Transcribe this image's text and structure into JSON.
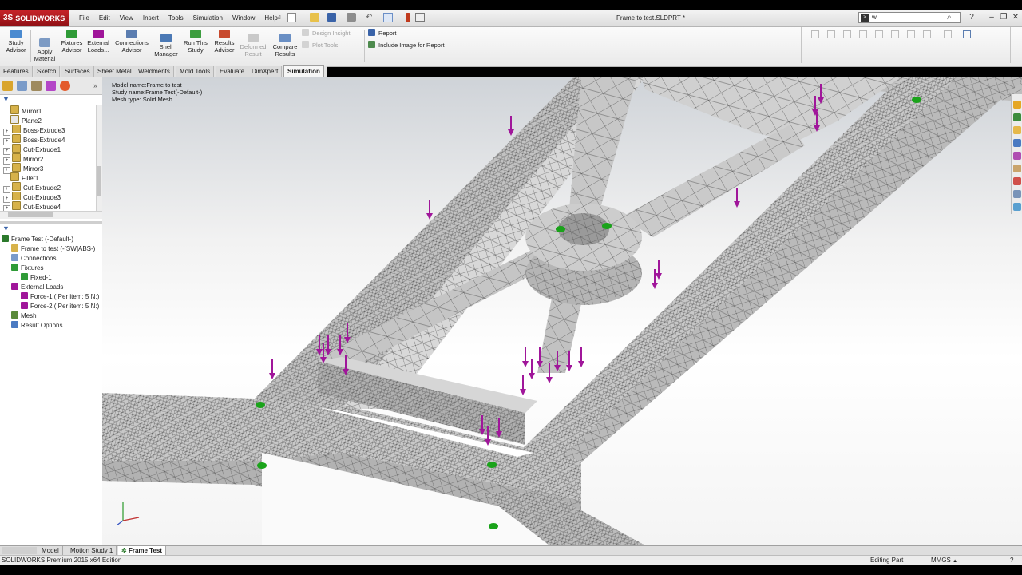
{
  "app": {
    "logo": "SOLIDWORKS",
    "logo_mark": "3S",
    "document_title": "Frame to test.SLDPRT *",
    "search_value": "w"
  },
  "menu": [
    "File",
    "Edit",
    "View",
    "Insert",
    "Tools",
    "Simulation",
    "Window",
    "Help"
  ],
  "command_manager": {
    "buttons": [
      {
        "label": "Study\nAdvisor",
        "icon": "study-advisor-icon"
      },
      {
        "label": "Apply\nMaterial",
        "icon": "apply-material-icon"
      },
      {
        "label": "Fixtures\nAdvisor",
        "icon": "fixtures-icon"
      },
      {
        "label": "External\nLoads...",
        "icon": "external-loads-icon"
      },
      {
        "label": "Connections\nAdvisor",
        "icon": "connections-icon"
      },
      {
        "label": "Shell\nManager",
        "icon": "shell-manager-icon"
      },
      {
        "label": "Run This\nStudy",
        "icon": "run-study-icon"
      },
      {
        "label": "Results\nAdvisor",
        "icon": "results-advisor-icon"
      },
      {
        "label": "Deformed\nResult",
        "icon": "deformed-result-icon",
        "disabled": true
      },
      {
        "label": "Compare\nResults",
        "icon": "compare-results-icon"
      }
    ],
    "design_insight": "Design Insight",
    "plot_tools": "Plot Tools",
    "report": "Report",
    "include_image": "Include Image for Report"
  },
  "tabs": [
    "Features",
    "Sketch",
    "Surfaces",
    "Sheet Metal",
    "Weldments",
    "Mold Tools",
    "Evaluate",
    "DimXpert",
    "Simulation"
  ],
  "active_tab": "Simulation",
  "feature_tree": [
    {
      "label": "Mirror1",
      "expand": false
    },
    {
      "label": "Plane2",
      "expand": false
    },
    {
      "label": "Boss-Extrude3",
      "expand": true
    },
    {
      "label": "Boss-Extrude4",
      "expand": true
    },
    {
      "label": "Cut-Extrude1",
      "expand": true
    },
    {
      "label": "Mirror2",
      "expand": true
    },
    {
      "label": "Mirror3",
      "expand": true
    },
    {
      "label": "Fillet1",
      "expand": false
    },
    {
      "label": "Cut-Extrude2",
      "expand": true
    },
    {
      "label": "Cut-Extrude3",
      "expand": true
    },
    {
      "label": "Cut-Extrude4",
      "expand": true
    }
  ],
  "study_tree": [
    {
      "label": "Frame Test (-Default-)",
      "level": 0
    },
    {
      "label": "Frame to test (-[SW]ABS-)",
      "level": 1
    },
    {
      "label": "Connections",
      "level": 1
    },
    {
      "label": "Fixtures",
      "level": 1
    },
    {
      "label": "Fixed-1",
      "level": 2
    },
    {
      "label": "External Loads",
      "level": 1
    },
    {
      "label": "Force-1 (:Per item: 5 N:)",
      "level": 2
    },
    {
      "label": "Force-2 (:Per item: 5 N:)",
      "level": 2
    },
    {
      "label": "Mesh",
      "level": 1
    },
    {
      "label": "Result Options",
      "level": 1
    }
  ],
  "viewport": {
    "model_name": "Model name:Frame to test",
    "study_name": "Study name:Frame Test(-Default-)",
    "mesh_type": "Mesh type: Solid Mesh"
  },
  "bottom_tabs": [
    "Model",
    "Motion Study 1",
    "Frame Test"
  ],
  "active_bottom_tab": "Frame Test",
  "status": {
    "edition": "SOLIDWORKS Premium 2015 x64 Edition",
    "mode": "Editing Part",
    "units": "MMGS"
  },
  "colors": {
    "load_arrow": "#a0169a",
    "fixture": "#1aa31a",
    "mesh_face": "#c9c9c9",
    "mesh_line": "#4d4d4d"
  }
}
